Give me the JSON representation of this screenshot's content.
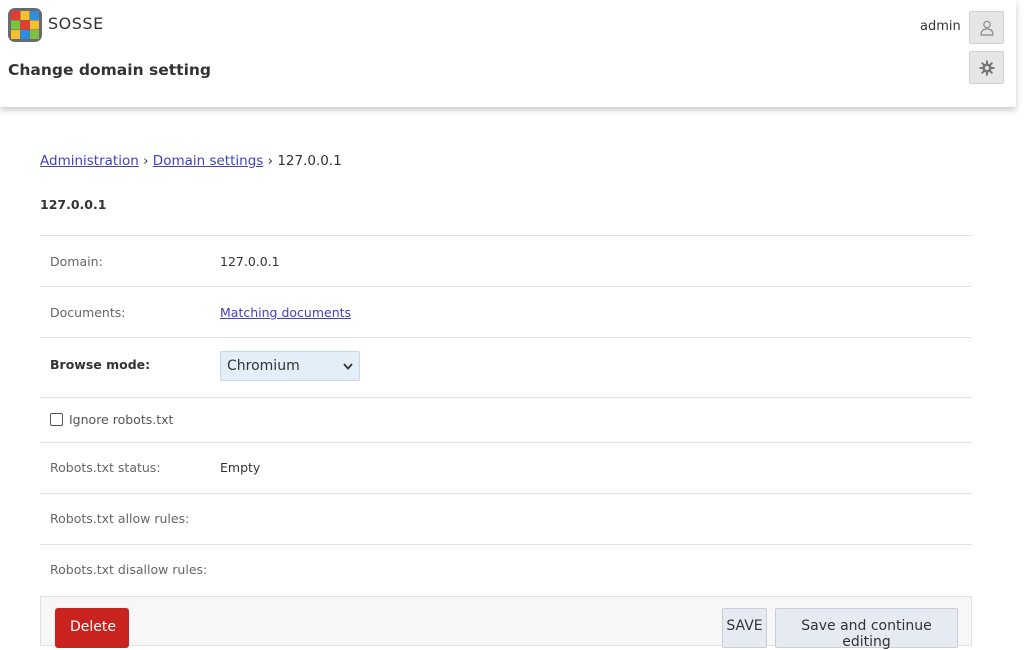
{
  "header": {
    "brand": "SOSSE",
    "page_title": "Change domain setting",
    "username": "admin",
    "icons": {
      "logo": "sosse-logo",
      "user": "user-icon",
      "settings": "gear-icon"
    }
  },
  "breadcrumb": {
    "items": [
      "Administration",
      "Domain settings"
    ],
    "separator": "›",
    "current": "127.0.0.1"
  },
  "object_title": "127.0.0.1",
  "form": {
    "domain": {
      "label": "Domain:",
      "value": "127.0.0.1"
    },
    "documents": {
      "label": "Documents:",
      "link": "Matching documents"
    },
    "browse_mode": {
      "label": "Browse mode:",
      "selected": "Chromium"
    },
    "ignore_robots": {
      "label": "Ignore robots.txt",
      "checked": false
    },
    "robots_status": {
      "label": "Robots.txt status:",
      "value": "Empty"
    },
    "robots_allow": {
      "label": "Robots.txt allow rules:",
      "value": ""
    },
    "robots_disallow": {
      "label": "Robots.txt disallow rules:",
      "value": ""
    }
  },
  "actions": {
    "delete": "Delete",
    "save": "SAVE",
    "save_continue": "Save and continue editing"
  },
  "colors": {
    "link": "#4040c8",
    "delete": "#c9231f",
    "button_bg": "#e6eaf2",
    "select_bg": "#e4eef9"
  }
}
